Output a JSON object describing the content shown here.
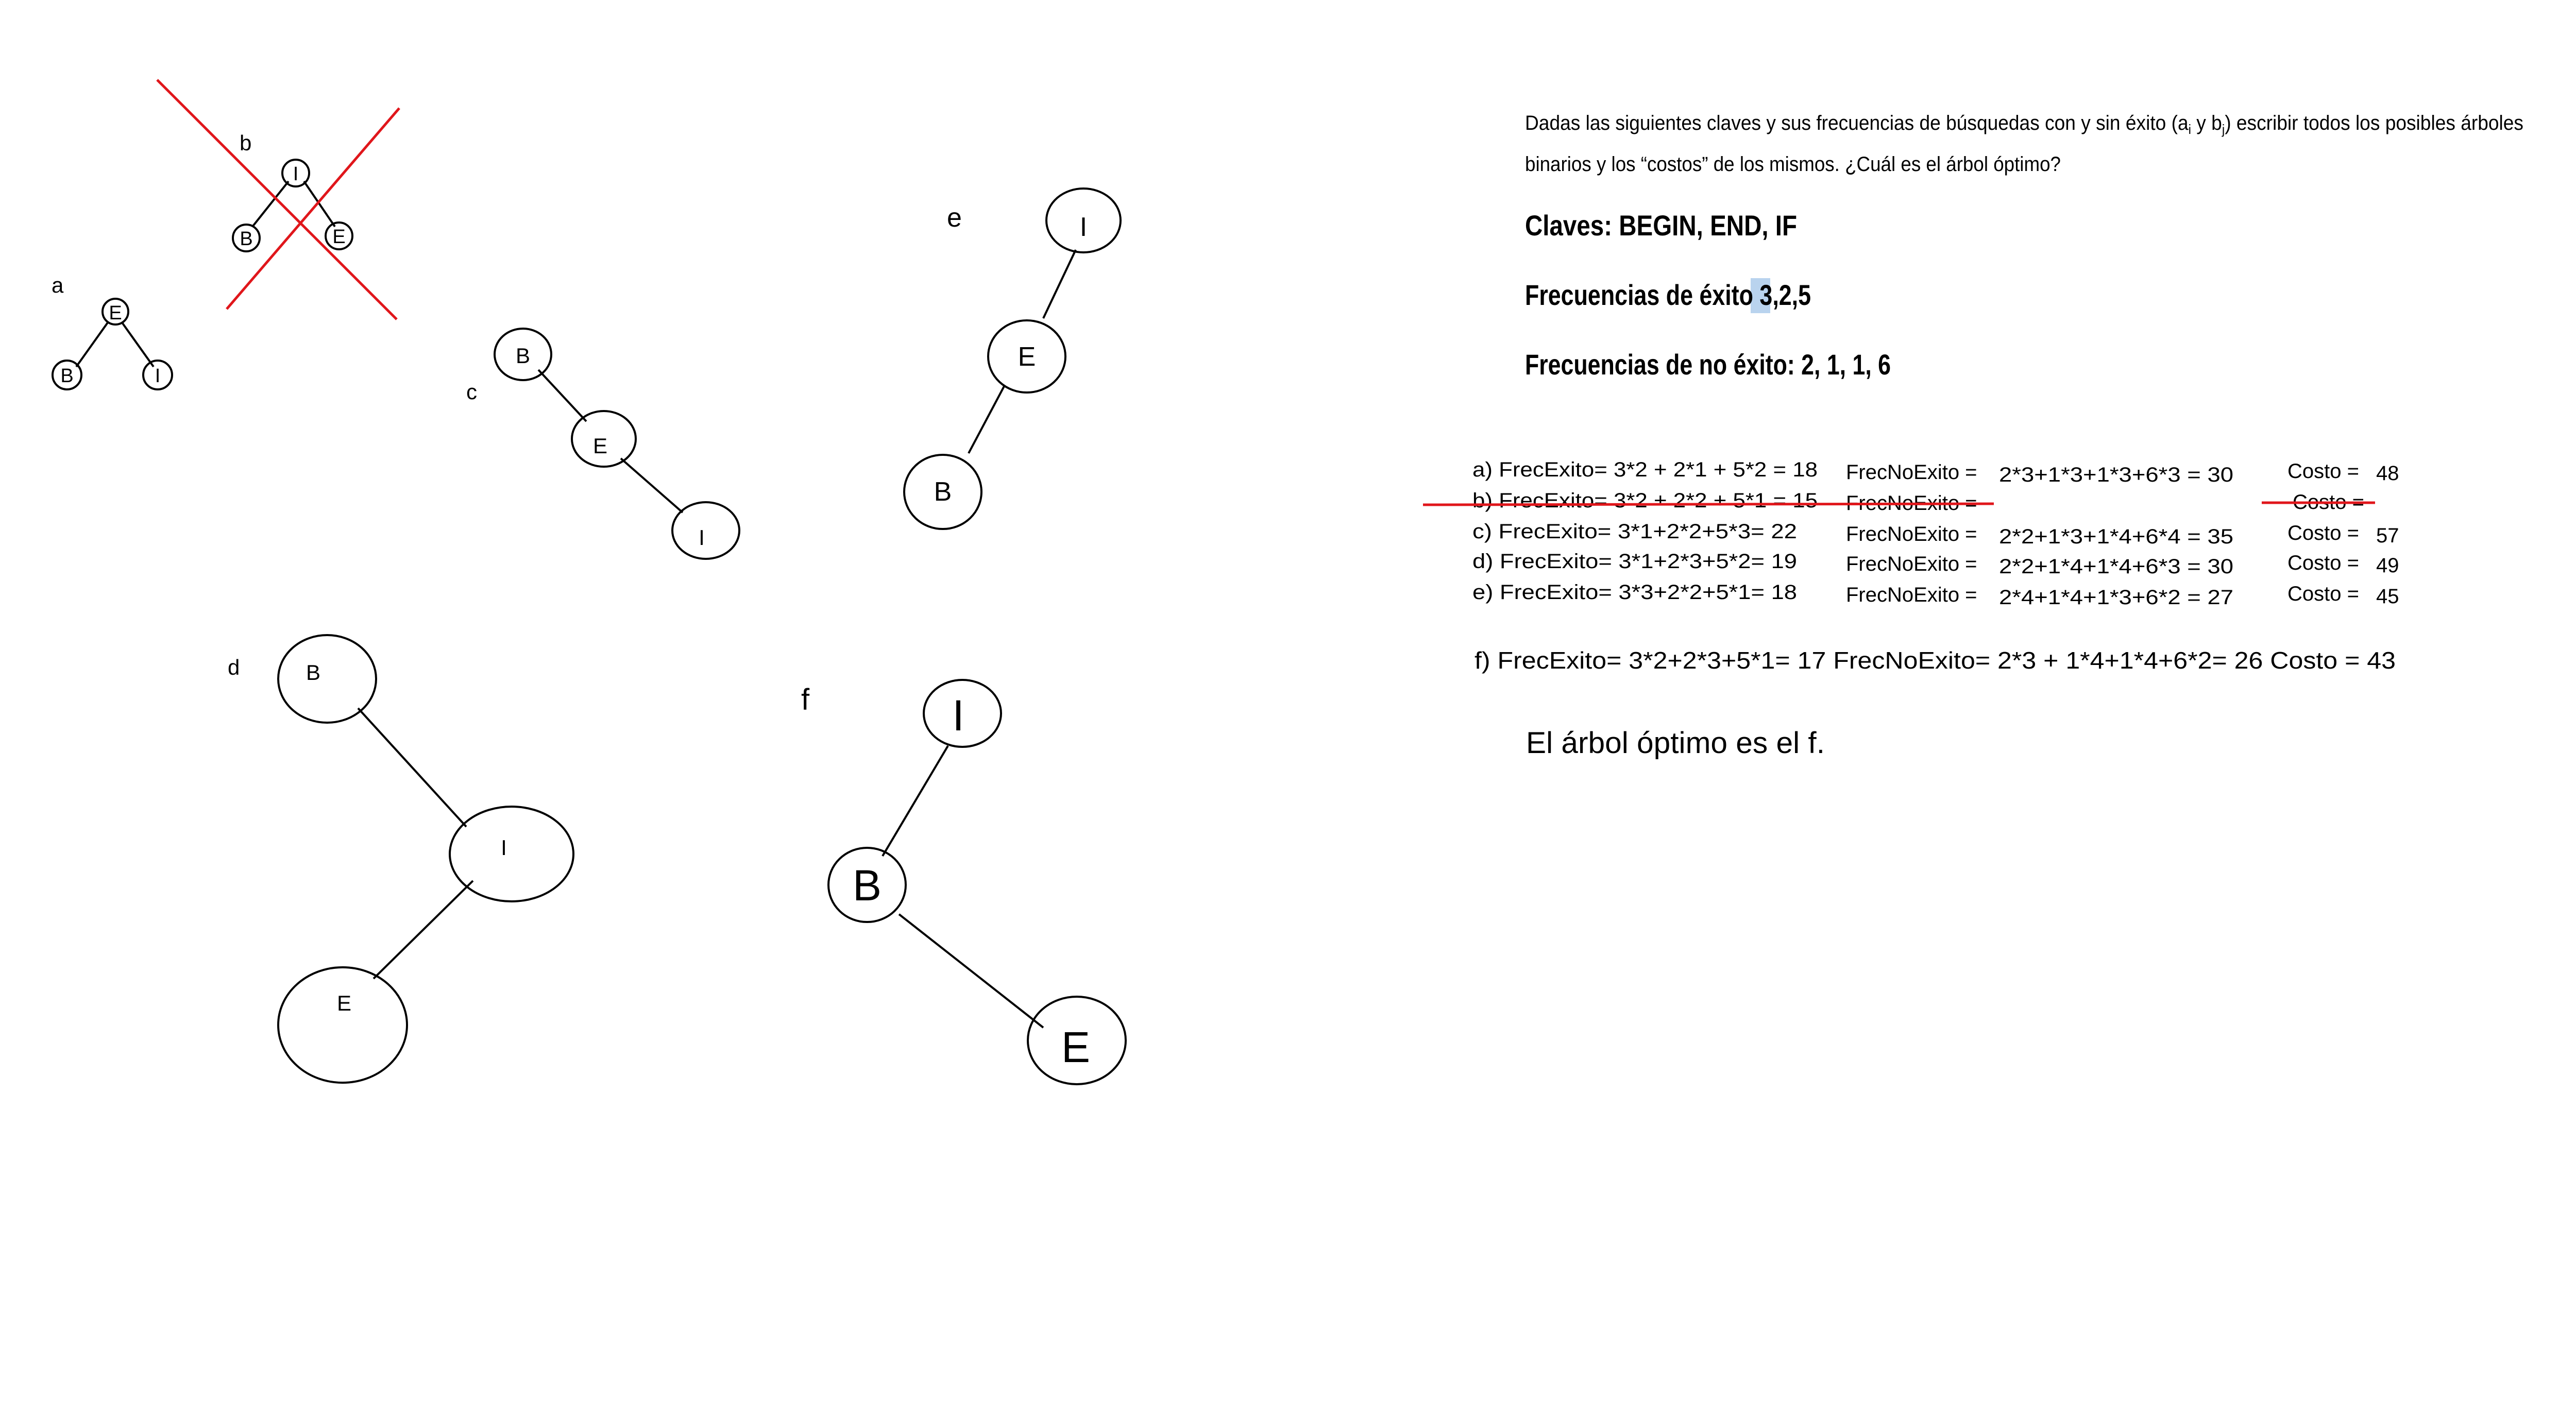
{
  "colors": {
    "ink": "#000000",
    "strike": "#e0161b",
    "highlight": "#b9d3ee"
  },
  "trees": [
    {
      "id": "a",
      "label": "a",
      "nodes": [
        "E",
        "B",
        "I"
      ]
    },
    {
      "id": "b",
      "label": "b",
      "nodes": [
        "I",
        "B",
        "E"
      ],
      "crossed_out": true
    },
    {
      "id": "c",
      "label": "c",
      "nodes": [
        "B",
        "E",
        "I"
      ]
    },
    {
      "id": "d",
      "label": "d",
      "nodes": [
        "B",
        "I",
        "E"
      ]
    },
    {
      "id": "e",
      "label": "e",
      "nodes": [
        "I",
        "E",
        "B"
      ]
    },
    {
      "id": "f",
      "label": "f",
      "nodes": [
        "I",
        "B",
        "E"
      ]
    }
  ],
  "problem": {
    "line1_pre": "Dadas las siguientes claves y sus frecuencias de búsquedas con y sin éxito (a",
    "sub_i": "i",
    "line1_mid": " y b",
    "sub_j": "j",
    "line1_post": ") escribir todos los posibles árboles",
    "line2": "binarios y los “costos” de los mismos. ¿Cuál es el árbol óptimo?",
    "keys": "Claves: BEGIN, END, IF",
    "success_label": "Frecuencias de éxito ",
    "success_highlight": "3",
    "success_rest": ",2,5",
    "failure": "Frecuencias de no éxito: 2, 1, 1, 6"
  },
  "calculations": [
    {
      "id": "a",
      "frec_exito": "a) FrecExito= 3*2 + 2*1 + 5*2 = 18",
      "frec_no_exito_label": "FrecNoExito =",
      "frec_no_exito_value": "2*3+1*3+1*3+6*3 = 30",
      "costo_label": "Costo =",
      "costo_value": "48"
    },
    {
      "id": "b",
      "frec_exito": "b) FrecExito= 3*2 + 2*2 + 5*1 = 15",
      "frec_no_exito_label": "FrecNoExito =",
      "frec_no_exito_value": "",
      "costo_label": "Costo =",
      "costo_value": "",
      "crossed_out": true
    },
    {
      "id": "c",
      "frec_exito": "c)  FrecExito= 3*1+2*2+5*3= 22",
      "frec_no_exito_label": "FrecNoExito =",
      "frec_no_exito_value": "2*2+1*3+1*4+6*4 = 35",
      "costo_label": "Costo =",
      "costo_value": "57"
    },
    {
      "id": "d",
      "frec_exito": "d)  FrecExito= 3*1+2*3+5*2= 19",
      "frec_no_exito_label": "FrecNoExito =",
      "frec_no_exito_value": "2*2+1*4+1*4+6*3 = 30",
      "costo_label": "Costo =",
      "costo_value": "49"
    },
    {
      "id": "e",
      "frec_exito": "e)  FrecExito= 3*3+2*2+5*1= 18",
      "frec_no_exito_label": "FrecNoExito =",
      "frec_no_exito_value": "2*4+1*4+1*3+6*2 = 27",
      "costo_label": "Costo =",
      "costo_value": "45"
    }
  ],
  "calc_f": "f) FrecExito= 3*2+2*3+5*1= 17     FrecNoExito= 2*3 + 1*4+1*4+6*2= 26    Costo = 43",
  "conclusion": "El árbol óptimo es el f."
}
